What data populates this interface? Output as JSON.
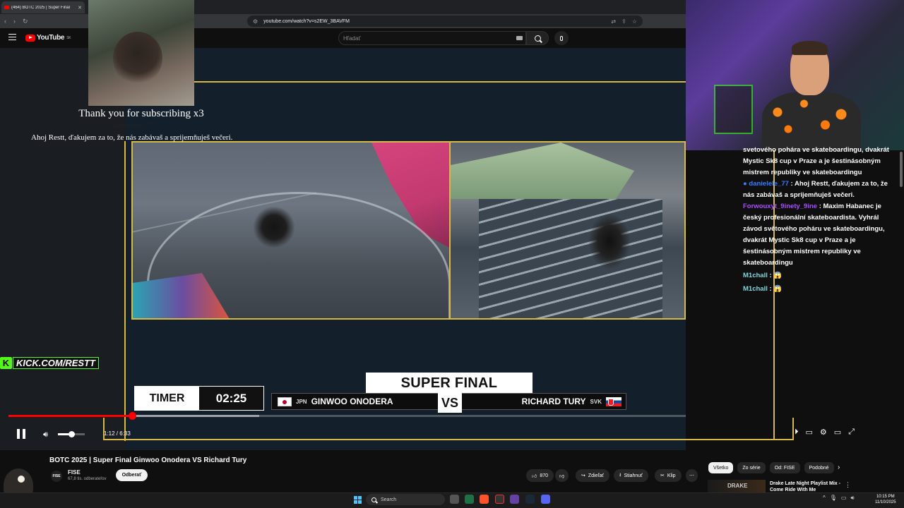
{
  "browser": {
    "tab_title": "(464) BOTC 2025 | Super Final",
    "url": "youtube.com/watch?v=s2EW_3BAVFM"
  },
  "youtube": {
    "logo_text": "YouTube",
    "region": "SK",
    "search_placeholder": "Hľadať"
  },
  "overlay": {
    "alert_title": "Thank you for subscribing x3",
    "alert_user": "danielele_77",
    "alert_message": "Ahoj Restt, ďakujem za to, že nás zabávaš a sprijemňuješ večeri.",
    "kick_text": "KICK.COM/RESTT",
    "kick_letter": "K"
  },
  "scoreboard": {
    "timer_label": "TIMER",
    "timer_value": "02:25",
    "title": "SUPER FINAL",
    "vs": "VS",
    "player1": {
      "country": "JPN",
      "name": "GINWOO ONODERA"
    },
    "player2": {
      "country": "SVK",
      "name": "RICHARD TURY"
    }
  },
  "player": {
    "time": "1:12 / 6:33",
    "progress_fraction": 0.183,
    "buffer_fraction": 0.37,
    "volume_fraction": 0.5
  },
  "chat": {
    "messages": [
      {
        "name": "",
        "text": "svetového pohára ve skateboardingu, dvakrát Mystic Sk8 cup v Praze a je šestinásobným mistrem republiky ve skateboardingu"
      },
      {
        "name": "danielele_77",
        "text": "Ahoj Restt, ďakujem za to, že nás zabávaš a sprijemňuješ večeri."
      },
      {
        "name": "Forwouxyt_9inety_9ine",
        "text": "Maxim Habanec je český profesionální skateboardista. Vyhrál závod světového poháru ve skateboardingu, dvakrát Mystic Sk8 cup v Praze a je šestinásobným mistrem republiky ve skateboardingu"
      },
      {
        "name": "M1chall",
        "text": "😱"
      },
      {
        "name": "M1chall",
        "text": "😱"
      }
    ]
  },
  "video_meta": {
    "title": "BOTC 2025 | Super Final Ginwoo Onodera VS Richard Tury",
    "channel": "FISE",
    "channel_avatar": "FISE",
    "subscribers": "67,8 tis. odberateľov",
    "subscribe_label": "Odberať",
    "likes": "870",
    "share_label": "Zdieľať",
    "download_label": "Stiahnuť",
    "clip_label": "Klip"
  },
  "chips": [
    "Všetko",
    "Zo série",
    "Od: FISE",
    "Podobné"
  ],
  "recommendation": {
    "thumb_text": "DRAKE",
    "title": "Drake Late Night Playlist Mix - Come Ride With Me"
  },
  "taskbar": {
    "search_label": "Search",
    "time": "10:15 PM",
    "date": "11/10/2025"
  },
  "colors": {
    "accent_gold": "#d7b94a",
    "youtube_red": "#ff0000",
    "kick_green": "#53fc18"
  }
}
